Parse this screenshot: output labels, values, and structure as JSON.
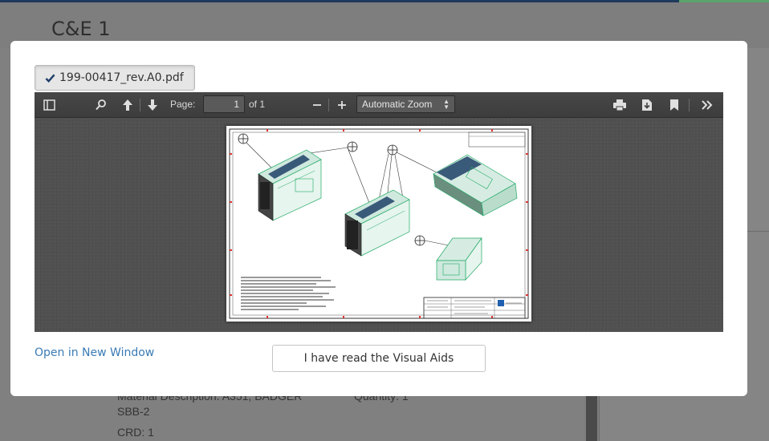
{
  "page": {
    "title": "C&E 1",
    "material_description": "Material Description: A351, BADGER",
    "material_description_cont": "SBB-2",
    "quantity": "Quantity: 1",
    "crd": "CRD: 1"
  },
  "modal": {
    "file_tab": {
      "label": "199-00417_rev.A0.pdf",
      "icon": "check-icon"
    },
    "viewer": {
      "page_label": "Page:",
      "page_number": "1",
      "page_of": "of 1",
      "zoom": "Automatic Zoom",
      "icons": [
        "sidebar-toggle-icon",
        "search-icon",
        "previous-page-icon",
        "next-page-icon",
        "zoom-out-icon",
        "zoom-in-icon",
        "print-icon",
        "download-icon",
        "bookmark-icon",
        "tools-icon"
      ]
    },
    "open_link": "Open in New Window",
    "ack_button": "I have read the Visual Aids"
  },
  "colors": {
    "link": "#3a7bb5",
    "toolbar": "#404040",
    "topbar": "#1f3a5c"
  }
}
